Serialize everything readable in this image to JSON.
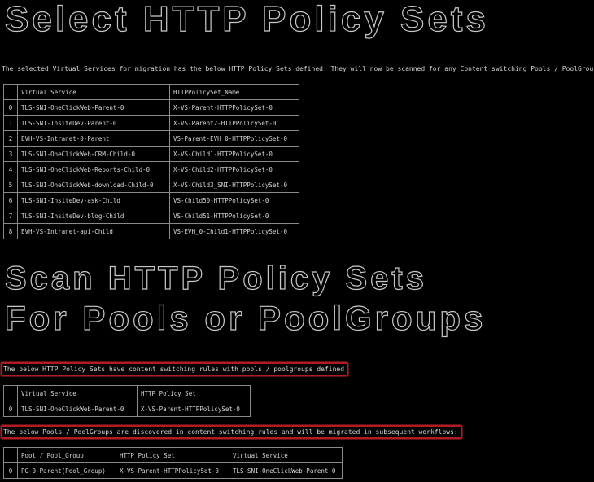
{
  "banners": {
    "select_title": "Select HTTP Policy Sets",
    "scan_title_line1": "Scan HTTP Policy Sets",
    "scan_title_line2": "For Pools or PoolGroups"
  },
  "intro_text": "The selected Virtual Services for migration has the below HTTP Policy Sets defined. They will now be scanned for any Content switching Pools / PoolGroups",
  "policy_table": {
    "headers": [
      "",
      "Virtual Service",
      "HTTPPolicySet_Name"
    ],
    "rows": [
      [
        "0",
        "TLS-SNI-OneClickWeb-Parent-0",
        "X-VS-Parent-HTTPPolicySet-0"
      ],
      [
        "1",
        "TLS-SNI-InsiteDev-Parent-0",
        "X-VS-Parent2-HTTPPolicySet-0"
      ],
      [
        "2",
        "EVH-VS-Intranet-0-Parent",
        "VS-Parent-EVH_0-HTTPPolicySet-0"
      ],
      [
        "3",
        "TLS-SNI-OneClickWeb-CRM-Child-0",
        "X-VS-Child1-HTTPPolicySet-0"
      ],
      [
        "4",
        "TLS-SNI-OneClickWeb-Reports-Child-0",
        "X-VS-Child2-HTTPPolicySet-0"
      ],
      [
        "5",
        "TLS-SNI-OneClickWeb-download-Child-0",
        "X-VS-Child3_SNI-HTTPPolicySet-0"
      ],
      [
        "6",
        "TLS-SNI-InsiteDev-ask-Child",
        "VS-Child50-HTTPPolicySet-0"
      ],
      [
        "7",
        "TLS-SNI-InsiteDev-blog-Child",
        "VS-Child51-HTTPPolicySet-0"
      ],
      [
        "8",
        "EVH-VS-Intranet-api-Child",
        "VS-EVH_0-Child1-HTTPPolicySet-0"
      ]
    ]
  },
  "notice_cs_rules": "The below HTTP Policy Sets have content switching rules with pools / poolgroups defined",
  "cs_table": {
    "headers": [
      "",
      "Virtual Service",
      "HTTP Policy Set"
    ],
    "rows": [
      [
        "0",
        "TLS-SNI-OneClickWeb-Parent-0",
        "X-VS-Parent-HTTPPolicySet-0"
      ]
    ]
  },
  "notice_pools": "The below Pools / PoolGroups are discovered in content switching rules and will be migrated in subsequent workflows:",
  "pools_table": {
    "headers": [
      "",
      "Pool / Pool_Group",
      "HTTP Policy Set",
      "Virtual Service"
    ],
    "rows": [
      [
        "0",
        "PG-0-Parent(Pool_Group)",
        "X-VS-Parent-HTTPPolicySet-0",
        "TLS-SNI-OneClickWeb-Parent-0"
      ]
    ]
  },
  "colors": {
    "background": "#000000",
    "text": "#d6d6d6",
    "highlight_border": "#b01c24"
  }
}
